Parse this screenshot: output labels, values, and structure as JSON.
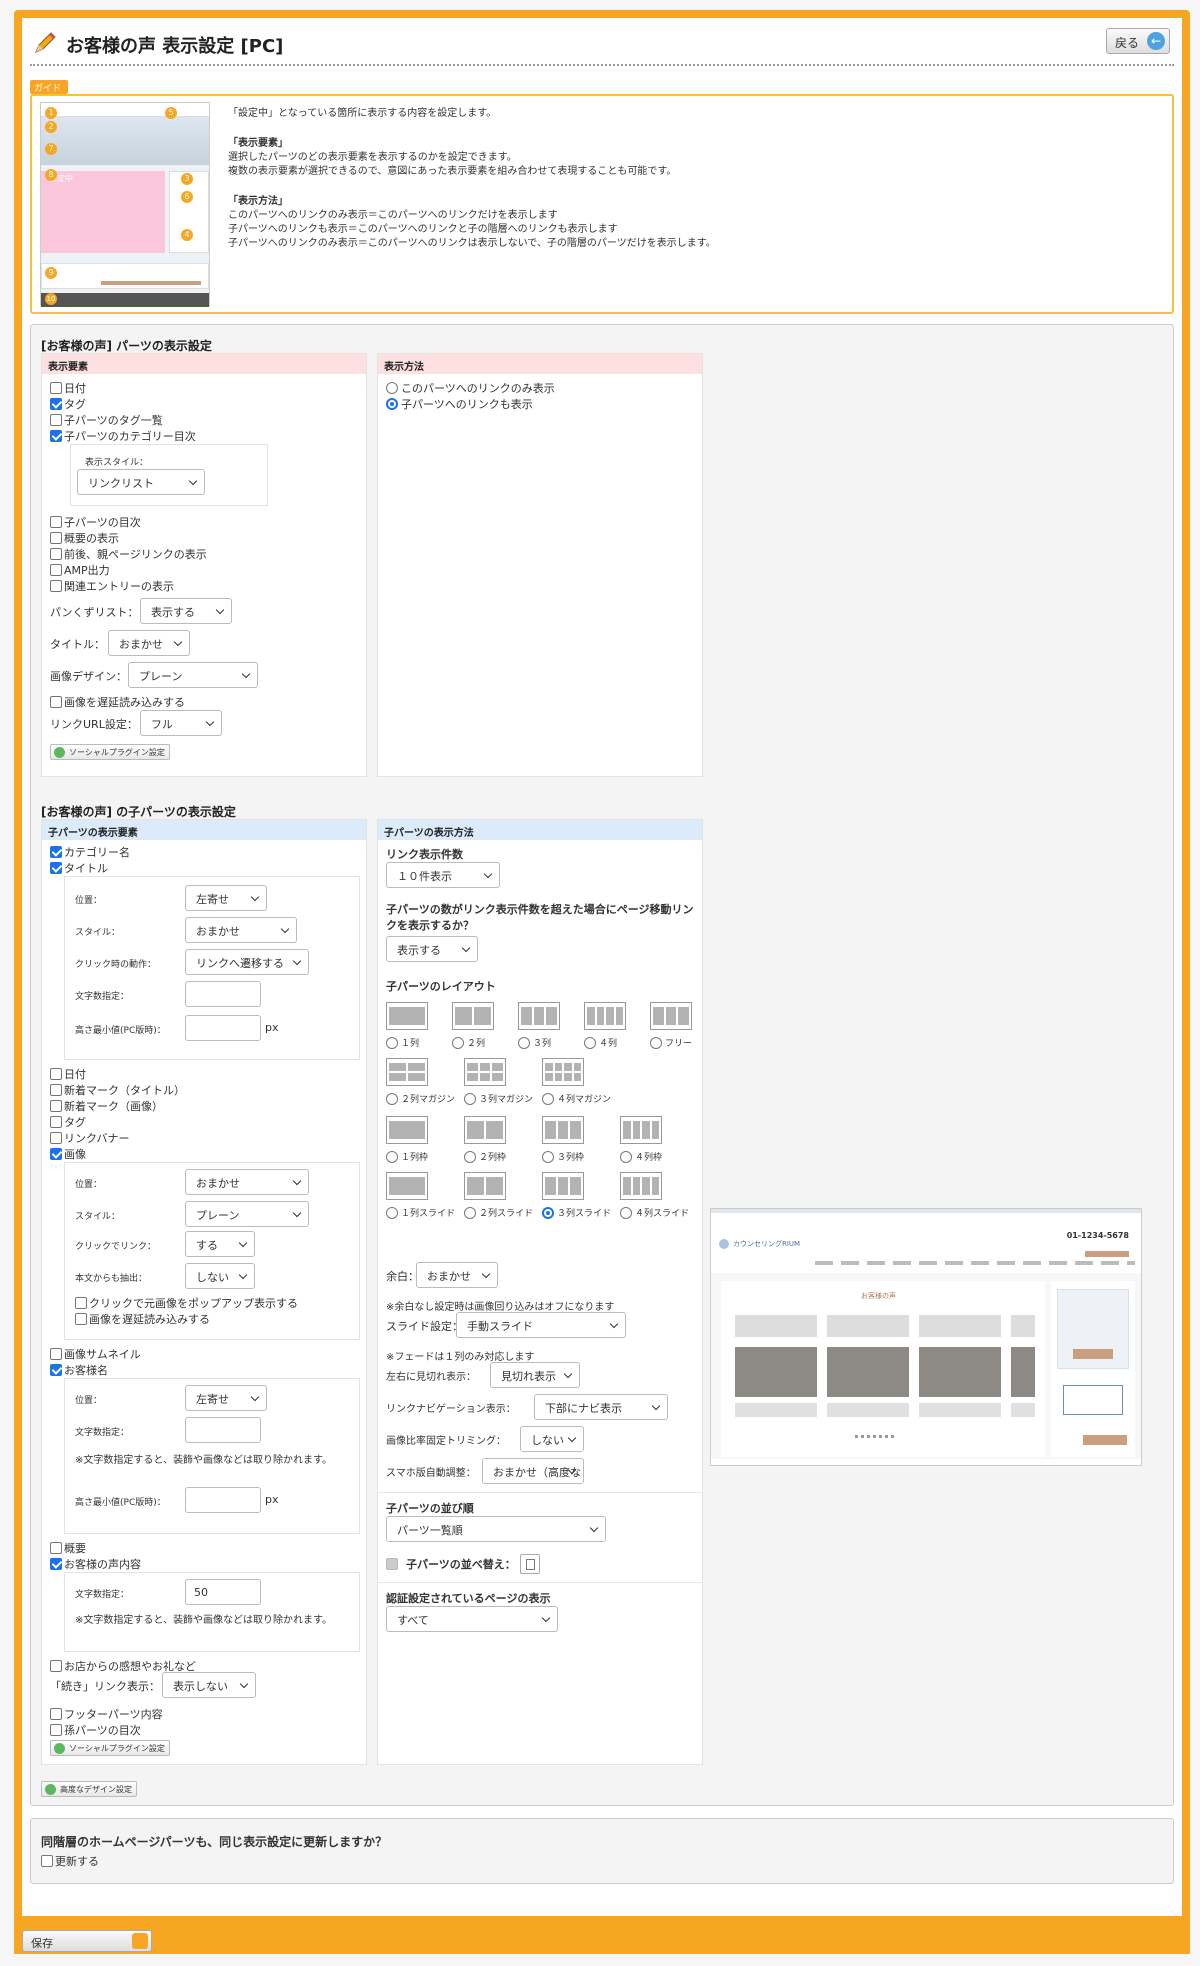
{
  "header": {
    "title": "お客様の声 表示設定 [PC]",
    "back_label": "戻る"
  },
  "guide": {
    "tab": "ガイド",
    "line1": "「設定中」となっている箇所に表示する内容を設定します。",
    "h1": "「表示要素」",
    "l2": "選択したパーツのどの表示要素を表示するのかを設定できます。",
    "l3": "複数の表示要素が選択できるので、意図にあった表示要素を組み合わせて表現することも可能です。",
    "h2": "「表示方法」",
    "l4": "このパーツへのリンクのみ表示＝このパーツへのリンクだけを表示します",
    "l5": "子パーツへのリンクも表示＝このパーツへのリンクと子の階層へのリンクも表示します",
    "l6": "子パーツへのリンクのみ表示＝このパーツへのリンクは表示しないで、子の階層のパーツだけを表示します。",
    "marker_setting": "設定中",
    "nums": [
      "1",
      "2",
      "3",
      "4",
      "5",
      "6",
      "7",
      "8",
      "9",
      "10"
    ]
  },
  "sec1": {
    "title": "[お客様の声] パーツの表示設定",
    "elements_header": "表示要素",
    "method_header": "表示方法",
    "cb_date": "日付",
    "cb_tag": "タグ",
    "cb_childtag": "子パーツのタグ一覧",
    "cb_childcat": "子パーツのカテゴリー目次",
    "style_label": "表示スタイル：",
    "style_value": "リンクリスト",
    "cb_childtoc": "子パーツの目次",
    "cb_summary": "概要の表示",
    "cb_prevnext": "前後、親ページリンクの表示",
    "cb_amp": "AMP出力",
    "cb_related": "関連エントリーの表示",
    "breadcrumb_label": "パンくずリスト：",
    "breadcrumb_value": "表示する",
    "title_label": "タイトル：",
    "title_value": "おまかせ",
    "imgdesign_label": "画像デザイン：",
    "imgdesign_value": "プレーン",
    "cb_lazy": "画像を遅延読み込みする",
    "linkurl_label": "リンクURL設定：",
    "linkurl_value": "フル",
    "social_btn": "ソーシャルプラグイン設定",
    "method_opt1": "このパーツへのリンクのみ表示",
    "method_opt2": "子パーツへのリンクも表示"
  },
  "sec2": {
    "title": "[お客様の声] の子パーツの表示設定",
    "elements_header": "子パーツの表示要素",
    "method_header": "子パーツの表示方法",
    "cb_catname": "カテゴリー名",
    "cb_title": "タイトル",
    "pos_label": "位置：",
    "pos_value": "左寄せ",
    "style_label": "スタイル：",
    "style_value": "おまかせ",
    "click_label": "クリック時の動作：",
    "click_value": "リンクへ遷移する",
    "chars_label": "文字数指定：",
    "minh_label": "高さ最小値(PC版時)：",
    "px": "px",
    "cb_date": "日付",
    "cb_newtitle": "新着マーク（タイトル）",
    "cb_newimg": "新着マーク（画像）",
    "cb_tag": "タグ",
    "cb_banner": "リンクバナー",
    "cb_image": "画像",
    "img_pos_value": "おまかせ",
    "img_style_value": "プレーン",
    "clicklink_label": "クリックでリンク：",
    "clicklink_value": "する",
    "extract_label": "本文からも抽出：",
    "extract_value": "しない",
    "cb_popup": "クリックで元画像をポップアップ表示する",
    "cb_lazy": "画像を遅延読み込みする",
    "cb_thumb": "画像サムネイル",
    "cb_name": "お客様名",
    "name_pos_value": "左寄せ",
    "note": "※文字数指定すると、装飾や画像などは取り除かれます。",
    "cb_overview": "概要",
    "cb_voice": "お客様の声内容",
    "voice_chars": "50",
    "cb_impression": "お店からの感想やお礼など",
    "more_label": "「続き」リンク表示：",
    "more_value": "表示しない",
    "cb_footer": "フッターパーツ内容",
    "cb_grandchild": "孫パーツの目次",
    "social_btn": "ソーシャルプラグイン設定",
    "advanced_btn": "高度なデザイン設定",
    "link_count_label": "リンク表示件数",
    "link_count_value": "１０件表示",
    "paging_q": "子パーツの数がリンク表示件数を超えた場合にページ移動リンクを表示するか？",
    "paging_value": "表示する",
    "layout_label": "子パーツのレイアウト",
    "layouts1": [
      "１列",
      "２列",
      "３列",
      "４列",
      "フリー"
    ],
    "layouts2": [
      "２列マガジン",
      "３列マガジン",
      "４列マガジン"
    ],
    "layouts3": [
      "１列枠",
      "２列枠",
      "３列枠",
      "４列枠"
    ],
    "layouts4": [
      "１列スライド",
      "２列スライド",
      "３列スライド",
      "４列スライド"
    ],
    "margin_label": "余白：",
    "margin_value": "おまかせ",
    "note_fade": "※余白なし設定時は画像回り込みはオフになります",
    "slide_label": "スライド設定：",
    "slide_value": "手動スライド",
    "note_fade2": "※フェードは１列のみ対応します",
    "peek_label": "左右に見切れ表示：",
    "peek_value": "見切れ表示",
    "nav_label": "リンクナビゲーション表示：",
    "nav_value": "下部にナビ表示",
    "trim_label": "画像比率固定トリミング：",
    "trim_value": "しない",
    "sp_label": "スマホ版自動調整：",
    "sp_value": "おまかせ（高度な",
    "order_label": "子パーツの並び順",
    "order_value": "パーツ一覧順",
    "sort_label": "子パーツの並べ替え：",
    "auth_label": "認証設定されているページの表示",
    "auth_value": "すべて"
  },
  "preview": {
    "brand": "カウンセリングRIUM",
    "phone": "01-1234-5678",
    "page_title": "お客様の声"
  },
  "bottom": {
    "question": "同階層のホームページパーツも、同じ表示設定に更新しますか？",
    "cb_update": "更新する"
  },
  "footer": {
    "save_label": "保存"
  },
  "colors": {
    "accent": "#f6a623",
    "check": "#1a73e8"
  }
}
